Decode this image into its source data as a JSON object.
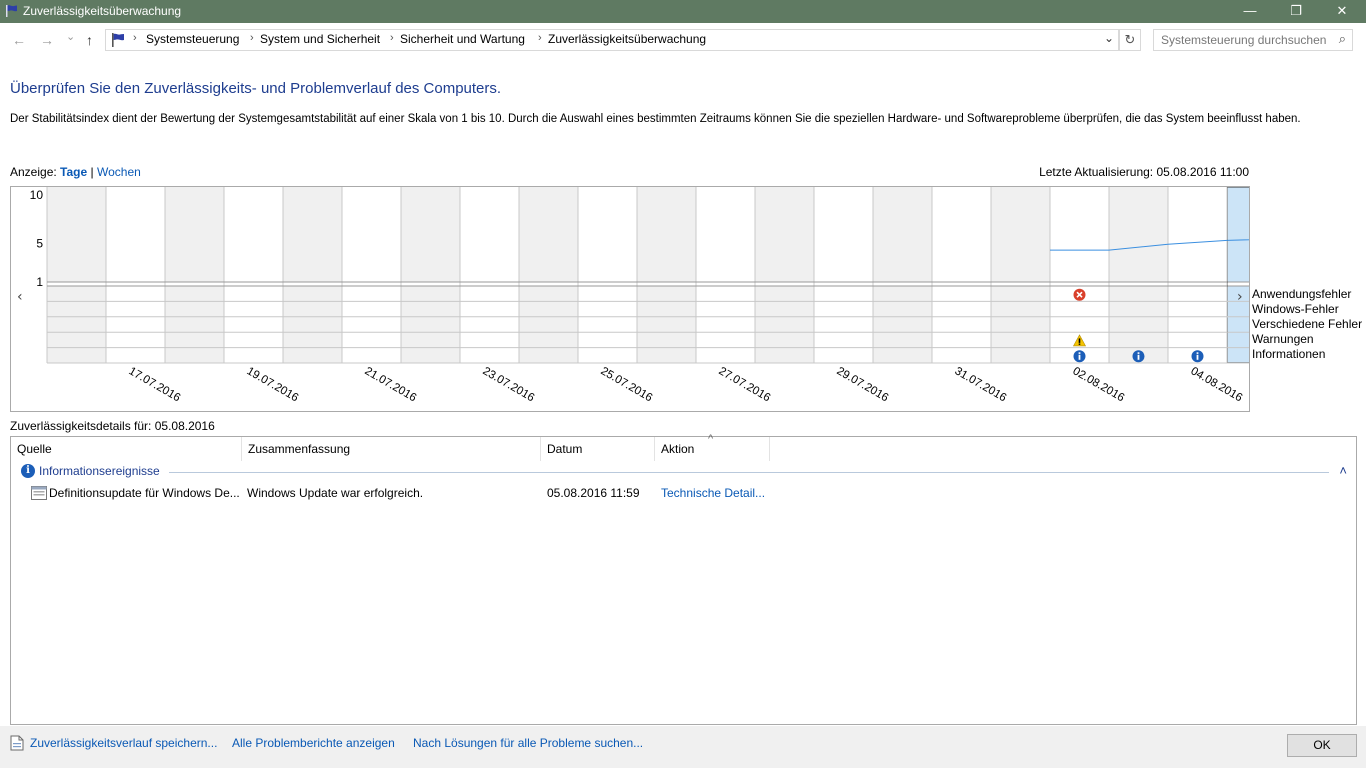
{
  "window": {
    "title": "Zuverlässigkeitsüberwachung",
    "minimize": "—",
    "maximize": "❐",
    "close": "✕"
  },
  "nav": {
    "back": "←",
    "forward": "→",
    "dropdown": "⌄",
    "up": "↑",
    "breadcrumbs": [
      "Systemsteuerung",
      "System und Sicherheit",
      "Sicherheit und Wartung",
      "Zuverlässigkeitsüberwachung"
    ],
    "crumb_sep": "›",
    "addr_dropdown": "⌄",
    "refresh": "↻",
    "search_placeholder": "Systemsteuerung durchsuchen",
    "search_icon": "⌕"
  },
  "page": {
    "heading": "Überprüfen Sie den Zuverlässigkeits- und Problemverlauf des Computers.",
    "description": "Der Stabilitätsindex dient der Bewertung der Systemgesamtstabilität auf einer Skala von 1 bis 10. Durch die Auswahl eines bestimmten Zeitraums können Sie die speziellen Hardware- und Softwareprobleme überprüfen, die das System beeinflusst haben.",
    "view_label": "Anzeige:",
    "view_days": "Tage",
    "view_sep": "|",
    "view_weeks": "Wochen",
    "last_update": "Letzte Aktualisierung: 05.08.2016 11:00"
  },
  "chart_data": {
    "type": "line",
    "y_ticks": [
      "10",
      "5",
      "1"
    ],
    "ylim": [
      1,
      10
    ],
    "nav_left": "‹",
    "nav_right": "›",
    "days": [
      "16.07.2016",
      "17.07.2016",
      "18.07.2016",
      "19.07.2016",
      "20.07.2016",
      "21.07.2016",
      "22.07.2016",
      "23.07.2016",
      "24.07.2016",
      "25.07.2016",
      "26.07.2016",
      "27.07.2016",
      "28.07.2016",
      "29.07.2016",
      "30.07.2016",
      "31.07.2016",
      "01.08.2016",
      "02.08.2016",
      "03.08.2016",
      "04.08.2016",
      "05.08.2016"
    ],
    "x_labels": [
      "17.07.2016",
      "19.07.2016",
      "21.07.2016",
      "23.07.2016",
      "25.07.2016",
      "27.07.2016",
      "29.07.2016",
      "31.07.2016",
      "02.08.2016",
      "04.08.2016"
    ],
    "selected_day": "05.08.2016",
    "series": [
      {
        "values": [
          {
            "date": "02.08.2016",
            "y": 4.3
          },
          {
            "date": "03.08.2016",
            "y": 4.3
          },
          {
            "date": "04.08.2016",
            "y": 4.9
          },
          {
            "date": "05.08.2016",
            "y": 5.3
          },
          {
            "date": "05.08.2016 end",
            "y": 5.5
          }
        ]
      }
    ],
    "legend": [
      "Anwendungsfehler",
      "Windows-Fehler",
      "Verschiedene Fehler",
      "Warnungen",
      "Informationen"
    ],
    "events": [
      {
        "date": "02.08.2016",
        "row": "Anwendungsfehler",
        "icon": "error-icon"
      },
      {
        "date": "02.08.2016",
        "row": "Warnungen",
        "icon": "warning-icon"
      },
      {
        "date": "02.08.2016",
        "row": "Informationen",
        "icon": "info-icon"
      },
      {
        "date": "03.08.2016",
        "row": "Informationen",
        "icon": "info-icon"
      },
      {
        "date": "04.08.2016",
        "row": "Informationen",
        "icon": "info-icon"
      },
      {
        "date": "05.08.2016",
        "row": "Informationen",
        "icon": "info-icon"
      }
    ],
    "colors": {
      "line": "#3b8fe0",
      "shaded": "#f0f0f0",
      "selected": "#cce4f7",
      "grid": "#c8c8c8"
    }
  },
  "details": {
    "label": "Zuverlässigkeitsdetails für: 05.08.2016",
    "sort_indicator": "^",
    "columns": [
      "Quelle",
      "Zusammenfassung",
      "Datum",
      "Aktion"
    ],
    "group": {
      "icon": "info-icon",
      "label": "Informationsereignisse",
      "collapse": "˄"
    },
    "rows": [
      {
        "icon": "update-icon",
        "source": "Definitionsupdate für Windows De...",
        "summary": "Windows Update war erfolgreich.",
        "date": "05.08.2016 11:59",
        "action": "Technische Detail..."
      }
    ]
  },
  "footer": {
    "save_history": "Zuverlässigkeitsverlauf speichern...",
    "all_reports": "Alle Problemberichte anzeigen",
    "check_solutions": "Nach Lösungen für alle Probleme suchen...",
    "ok": "OK"
  }
}
